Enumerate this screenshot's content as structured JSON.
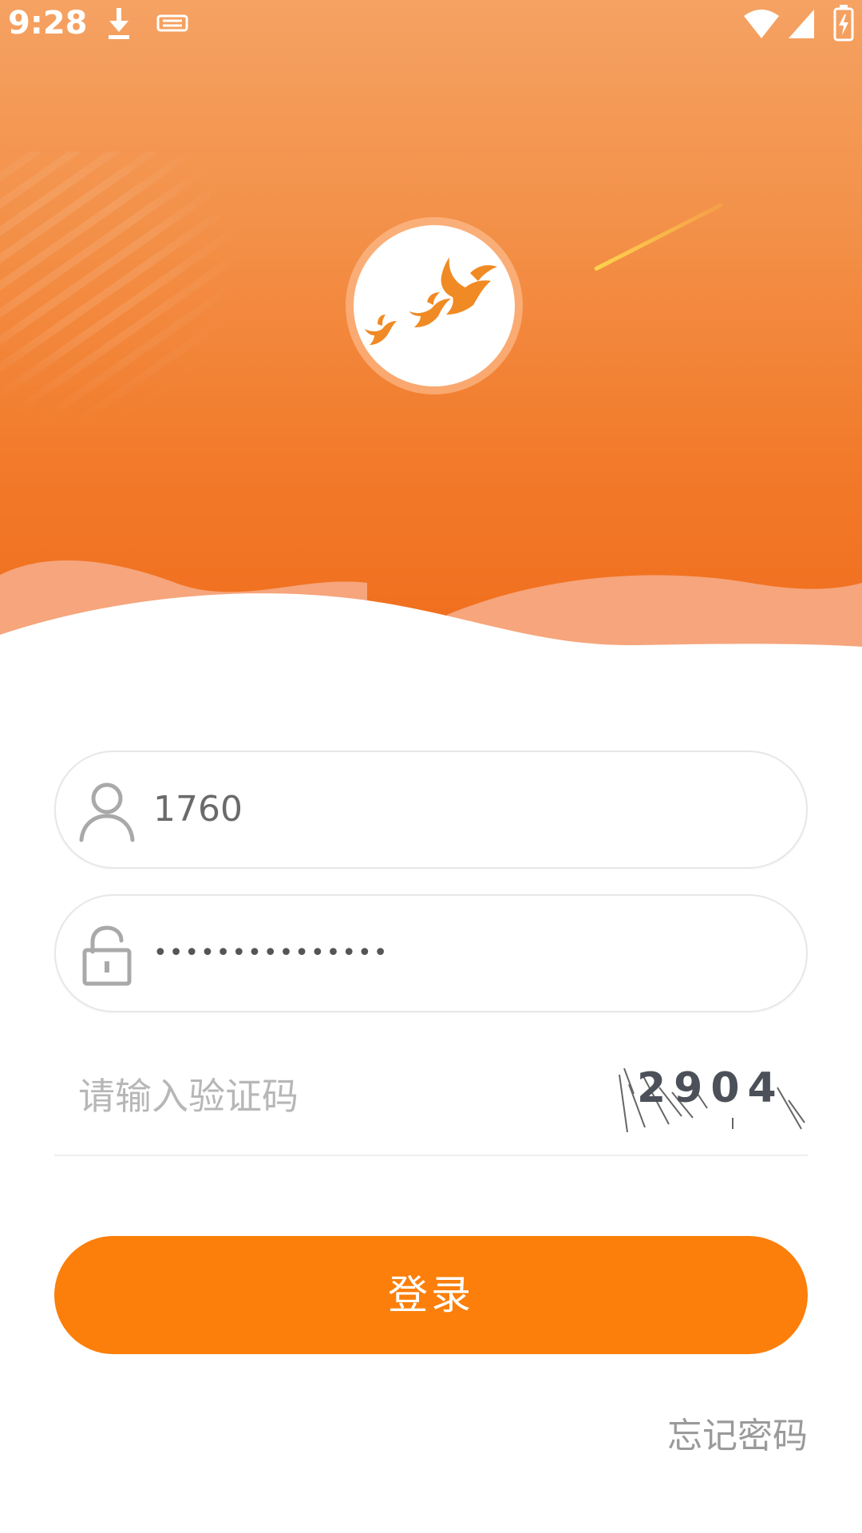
{
  "status_bar": {
    "time": "9:28",
    "icons": [
      "download-icon",
      "sd-card-icon",
      "wifi-icon",
      "signal-icon",
      "battery-charging-icon"
    ]
  },
  "header": {
    "logo": "flying-birds-logo"
  },
  "form": {
    "username": {
      "value": "1760",
      "icon": "user-icon"
    },
    "password": {
      "value": "•••••••••••••••",
      "icon": "lock-icon"
    },
    "captcha": {
      "placeholder": "请输入验证码",
      "code": "2904"
    },
    "login_label": "登录",
    "forgot_label": "忘记密码"
  },
  "colors": {
    "accent": "#fb7f0a",
    "header_top": "#f5a263",
    "header_bottom": "#f06d1c"
  }
}
